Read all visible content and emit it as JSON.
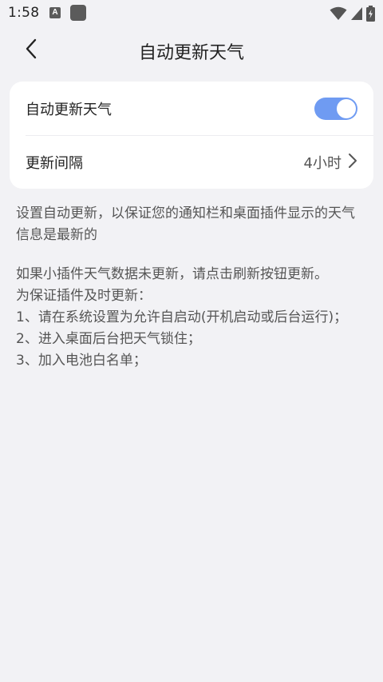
{
  "status_bar": {
    "time": "1:58",
    "notification_letter": "A",
    "icons": [
      "app-notification-icon",
      "square-notification-icon",
      "wifi-icon",
      "signal-icon",
      "battery-charging-icon"
    ]
  },
  "header": {
    "title": "自动更新天气",
    "back_icon": "chevron-left-icon"
  },
  "settings": {
    "auto_update": {
      "label": "自动更新天气",
      "enabled": true
    },
    "interval": {
      "label": "更新间隔",
      "value": "4小时",
      "icon": "chevron-right-icon"
    }
  },
  "description": {
    "paragraph1": "设置自动更新，以保证您的通知栏和桌面插件显示的天气信息是最新的",
    "paragraph2_lines": [
      "如果小插件天气数据未更新，请点击刷新按钮更新。",
      "为保证插件及时更新：",
      "1、请在系统设置为允许自启动(开机启动或后台运行)；",
      "2、进入桌面后台把天气锁住；",
      "3、加入电池白名单；"
    ]
  },
  "colors": {
    "background": "#f2f2f5",
    "card": "#ffffff",
    "toggle_on": "#6f9bf2",
    "text_primary": "#222222",
    "text_secondary": "#555555"
  }
}
